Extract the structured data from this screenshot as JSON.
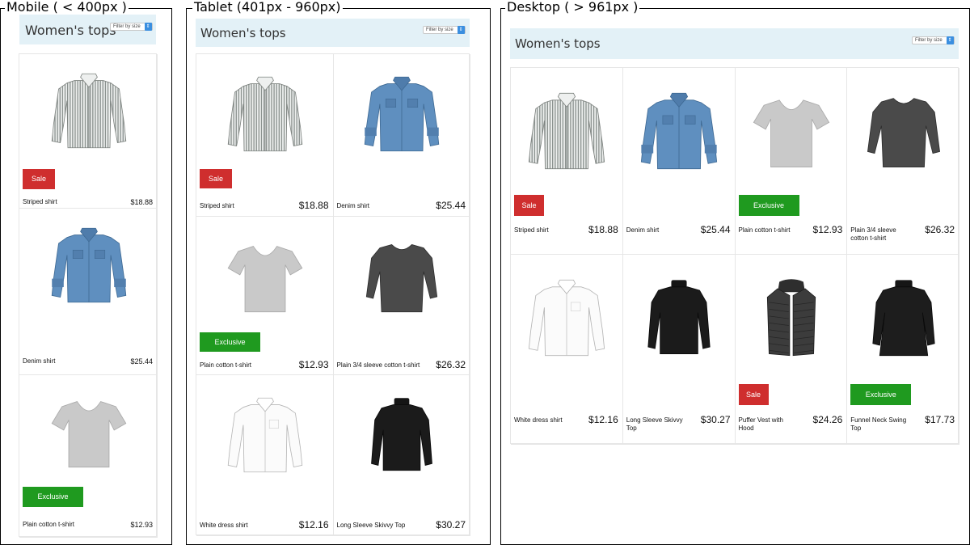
{
  "labels": {
    "mobile": "Mobile ( < 400px )",
    "tablet": "Tablet (401px - 960px)",
    "desktop": "Desktop ( > 961px )"
  },
  "page_title": "Women's tops",
  "filter_label": "Filter by size",
  "filter_arrow": "⇕",
  "badges": {
    "sale": "Sale",
    "exclusive": "Exclusive"
  },
  "colors": {
    "header_bg": "#e3f1f7",
    "sale": "#cf2e2e",
    "exclusive": "#1f9a1f",
    "filter_arrow": "#3b8fe0"
  },
  "products": [
    {
      "name": "Striped shirt",
      "price": "$18.88",
      "badge": "sale",
      "image": "striped-shirt"
    },
    {
      "name": "Denim shirt",
      "price": "$25.44",
      "badge": "",
      "image": "denim-shirt"
    },
    {
      "name": "Plain cotton t-shirt",
      "price": "$12.93",
      "badge": "exclusive",
      "image": "grey-tshirt"
    },
    {
      "name": "Plain 3/4 sleeve cotton t-shirt",
      "price": "$26.32",
      "badge": "",
      "image": "charcoal-tee"
    },
    {
      "name": "White dress shirt",
      "price": "$12.16",
      "badge": "",
      "image": "white-shirt"
    },
    {
      "name": "Long Sleeve Skivvy Top",
      "price": "$30.27",
      "badge": "",
      "image": "black-skivvy"
    },
    {
      "name": "Puffer Vest with Hood",
      "price": "$24.26",
      "badge": "sale",
      "image": "puffer-vest"
    },
    {
      "name": "Funnel Neck Swing Top",
      "price": "$17.73",
      "badge": "exclusive",
      "image": "funnel-neck-top"
    }
  ]
}
